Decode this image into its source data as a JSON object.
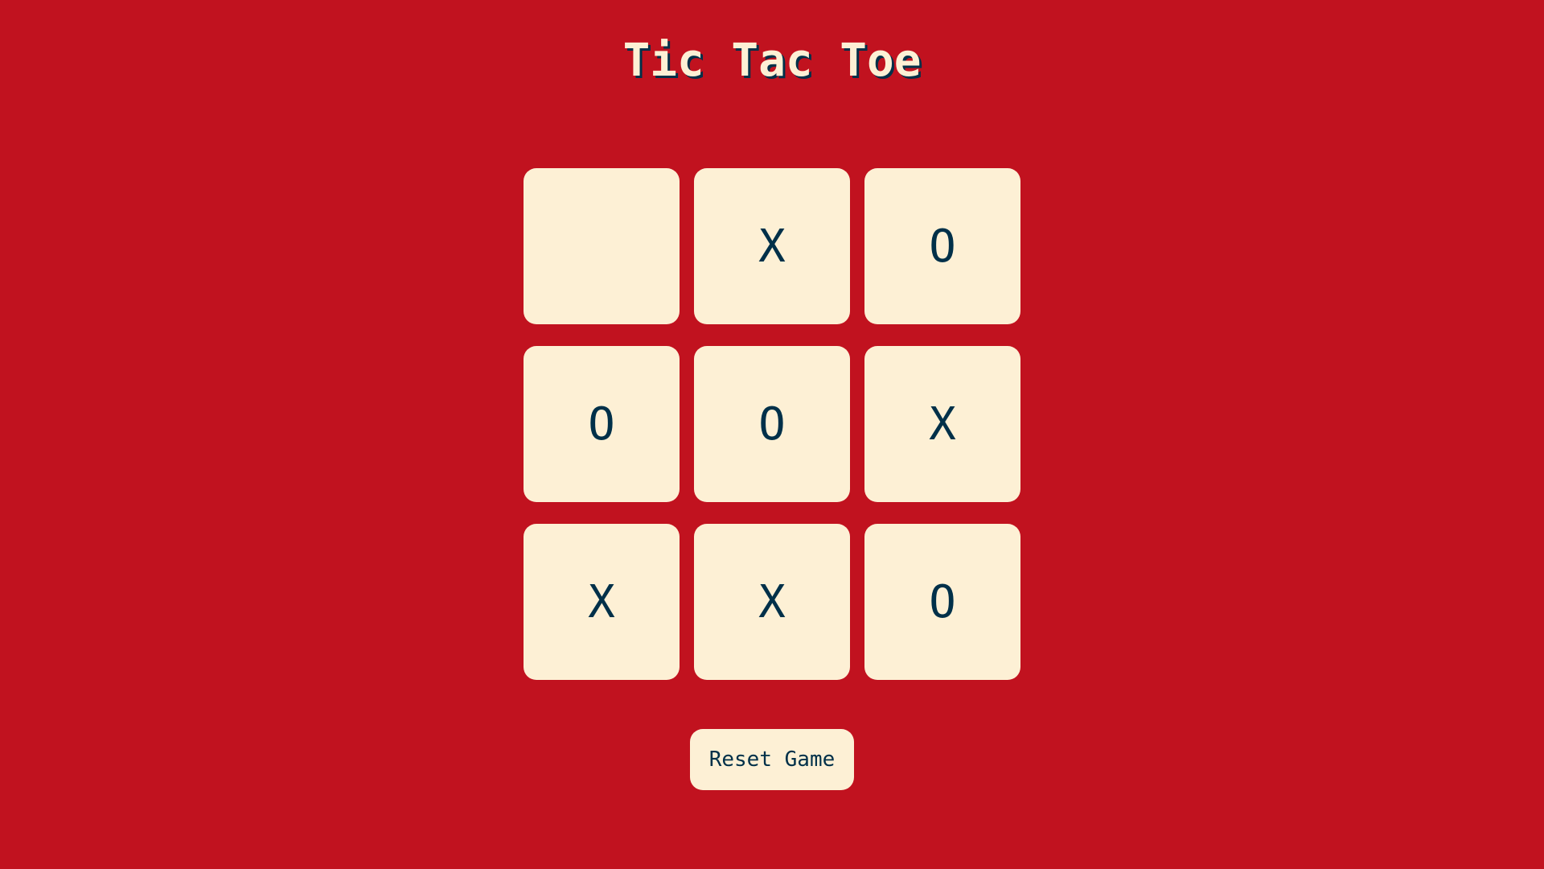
{
  "title": "Tic Tac Toe",
  "board": {
    "cells": [
      "",
      "X",
      "O",
      "O",
      "O",
      "X",
      "X",
      "X",
      "O"
    ]
  },
  "controls": {
    "reset_label": "Reset Game"
  },
  "colors": {
    "background": "#c1121f",
    "cell": "#fdf0d5",
    "mark": "#003049",
    "title": "#fdf0d5",
    "title_shadow": "#003049"
  }
}
